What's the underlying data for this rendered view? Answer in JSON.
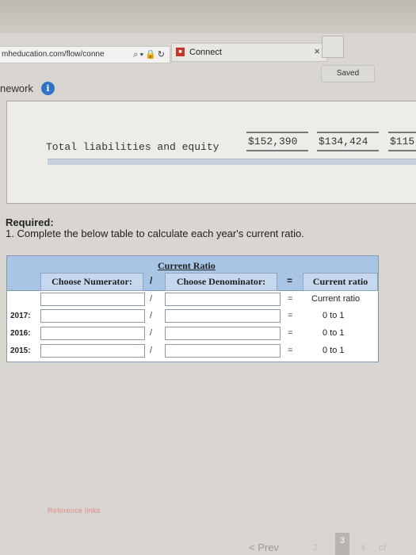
{
  "browser": {
    "url": "mheducation.com/flow/connе",
    "tab_label": "Connect",
    "tab_close": "×"
  },
  "assignment": {
    "title_fragment": "nework",
    "saved_label": "Saved"
  },
  "statement": {
    "row_label": "Total liabilities and equity",
    "values": [
      "$152,390",
      "$134,424",
      "$115"
    ]
  },
  "required": {
    "title": "Required:",
    "instruction": "1. Complete the below table to calculate each year's current ratio."
  },
  "table": {
    "title": "Current Ratio",
    "numerator_header": "Choose Numerator:",
    "divide_symbol": "/",
    "denominator_header": "Choose Denominator:",
    "equals_symbol": "=",
    "result_header": "Current ratio",
    "rows": [
      {
        "year": "",
        "numerator": "",
        "denominator": "",
        "result": "Current ratio"
      },
      {
        "year": "2017:",
        "numerator": "",
        "denominator": "",
        "result": "0 to 1"
      },
      {
        "year": "2016:",
        "numerator": "",
        "denominator": "",
        "result": "0 to 1"
      },
      {
        "year": "2015:",
        "numerator": "",
        "denominator": "",
        "result": "0 to 1"
      }
    ]
  },
  "footer": {
    "reference_link": "Reference links",
    "prev_label": "< Prev",
    "pages": [
      "2",
      "3",
      "4"
    ],
    "current_page": "3",
    "of_label": "of"
  }
}
